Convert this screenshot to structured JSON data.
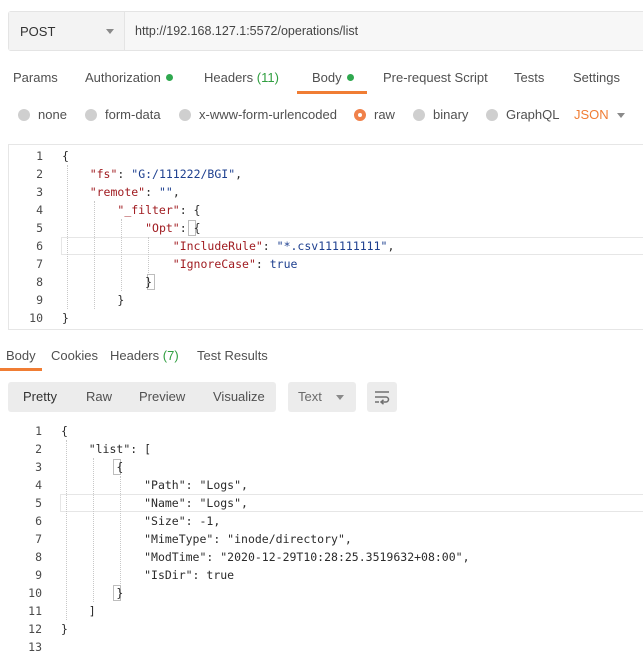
{
  "request": {
    "method": "POST",
    "url": "http://192.168.127.1:5572/operations/list"
  },
  "request_tabs": {
    "params": "Params",
    "authorization": "Authorization",
    "headers": "Headers",
    "headers_count": "(11)",
    "body": "Body",
    "prerequest": "Pre-request Script",
    "tests": "Tests",
    "settings": "Settings"
  },
  "body_types": {
    "none": "none",
    "form_data": "form-data",
    "urlencoded": "x-www-form-urlencoded",
    "raw": "raw",
    "binary": "binary",
    "graphql": "GraphQL",
    "format": "JSON",
    "selected": "raw"
  },
  "request_body": {
    "line_numbers": [
      "1",
      "2",
      "3",
      "4",
      "5",
      "6",
      "7",
      "8",
      "9",
      "10"
    ],
    "fs_key": "\"fs\"",
    "fs_value": "\"G:/111222/BGI\"",
    "remote_key": "\"remote\"",
    "remote_value": "\"\"",
    "filter_key": "\"_filter\"",
    "opt_key": "\"Opt\"",
    "include_key": "\"IncludeRule\"",
    "include_value": "\"*.csv111111111\"",
    "ignore_key": "\"IgnoreCase\"",
    "ignore_value": "true"
  },
  "response_tabs": {
    "body": "Body",
    "cookies": "Cookies",
    "headers": "Headers",
    "headers_count": "(7)",
    "test_results": "Test Results"
  },
  "response_view": {
    "pretty": "Pretty",
    "raw": "Raw",
    "preview": "Preview",
    "visualize": "Visualize",
    "format": "Text"
  },
  "response_body": {
    "line_numbers": [
      "1",
      "2",
      "3",
      "4",
      "5",
      "6",
      "7",
      "8",
      "9",
      "10",
      "11",
      "12",
      "13"
    ],
    "list_key": "\"list\": [",
    "path_line": "\"Path\": \"Logs\",",
    "name_line": "\"Name\": \"Logs\",",
    "size_line": "\"Size\": -1,",
    "mime_line": "\"MimeType\": \"inode/directory\",",
    "modtime_line": "\"ModTime\": \"2020-12-29T10:28:25.3519632+08:00\",",
    "isdir_line": "\"IsDir\": true"
  },
  "colors": {
    "accent": "#f07d34",
    "status_dot": "#2fa84f",
    "json_key": "#a01c21",
    "json_string": "#1d3f8f"
  }
}
